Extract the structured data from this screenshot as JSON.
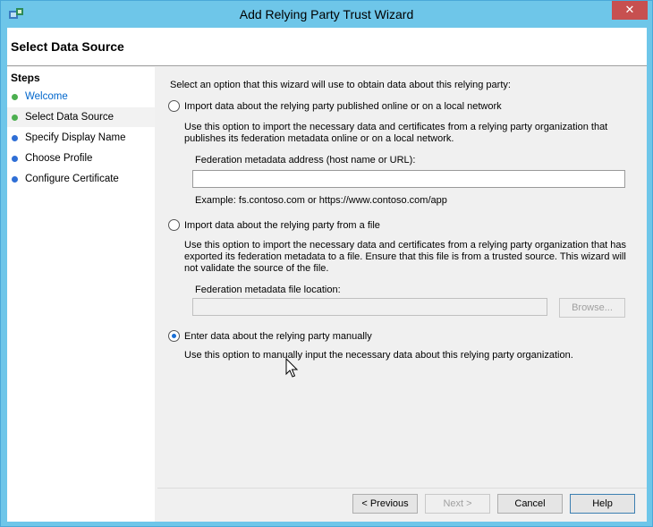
{
  "window": {
    "title": "Add Relying Party Trust Wizard",
    "close_glyph": "✕"
  },
  "header": {
    "title": "Select Data Source"
  },
  "steps": {
    "title": "Steps",
    "items": [
      {
        "label": "Welcome"
      },
      {
        "label": "Select Data Source"
      },
      {
        "label": "Specify Display Name"
      },
      {
        "label": "Choose Profile"
      },
      {
        "label": "Configure Certificate"
      }
    ]
  },
  "content": {
    "intro": "Select an option that this wizard will use to obtain data about this relying party:",
    "option1": {
      "label": "Import data about the relying party published online or on a local network",
      "desc_line1": "Use this option to import the necessary data and certificates from a relying party organization that",
      "desc_line2": "publishes its federation metadata online or on a local network.",
      "field_label": "Federation metadata address (host name or URL):",
      "field_value": "",
      "example": "Example: fs.contoso.com or https://www.contoso.com/app"
    },
    "option2": {
      "label": "Import data about the relying party from a file",
      "desc_line1": "Use this option to import the necessary data and certificates from a relying party organization that has",
      "desc_line2": "exported its federation metadata to a file. Ensure that this file is from a trusted source.  This wizard will",
      "desc_line3": "not validate the source of the file.",
      "field_label": "Federation metadata file location:",
      "field_value": "",
      "browse_label": "Browse..."
    },
    "option3": {
      "label": "Enter data about the relying party manually",
      "desc": "Use this option to manually input the necessary data about this relying party organization."
    }
  },
  "footer": {
    "previous": "< Previous",
    "next": "Next >",
    "cancel": "Cancel",
    "help": "Help"
  },
  "colors": {
    "title_bar": "#6ec6e9",
    "close_button": "#c75050",
    "link": "#0066cc",
    "step_done": "#4caf50",
    "step_todo": "#2f6fd6"
  }
}
